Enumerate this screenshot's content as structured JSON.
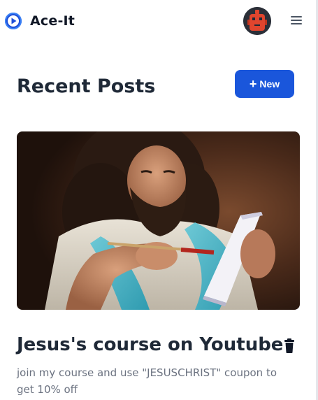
{
  "header": {
    "brand_name": "Ace-It",
    "logo_icon": "play-circle-icon",
    "avatar_icon": "robot-avatar",
    "menu_icon": "hamburger-menu-icon"
  },
  "main": {
    "heading": "Recent Posts",
    "new_button": {
      "icon": "plus-icon",
      "label": "New"
    }
  },
  "posts": [
    {
      "image_alt": "painting of a bearded man writing in a notebook",
      "title": "Jesus's course on Youtube",
      "description": "join my course and use \"JESUSCHRIST\" coupon to get 10% off",
      "delete_icon": "trash-icon"
    }
  ],
  "colors": {
    "accent": "#1a56db",
    "heading": "#1f2937",
    "muted": "#6b7280",
    "avatar_red": "#e0452e"
  }
}
